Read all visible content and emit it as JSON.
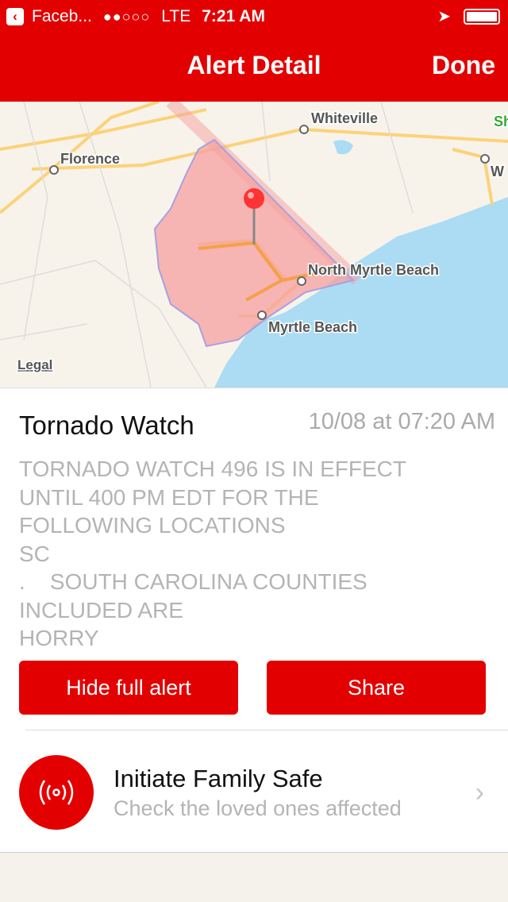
{
  "status_bar": {
    "back_app": "Faceb...",
    "signal": "●●○○○",
    "carrier": "LTE",
    "time": "7:21 AM"
  },
  "nav": {
    "title": "Alert Detail",
    "done_label": "Done"
  },
  "map": {
    "labels": [
      "Whiteville",
      "Florence",
      "North Myrtle Beach",
      "Myrtle Beach",
      "Sh",
      "W"
    ],
    "legal": "Legal",
    "polygon_color": "#f5a0a0",
    "water_color": "#abdcf3"
  },
  "alert": {
    "title": "Tornado Watch",
    "time": "10/08 at 07:20 AM",
    "body": "TORNADO WATCH 496 IS IN EFFECT\nUNTIL 400 PM EDT FOR THE\nFOLLOWING LOCATIONS\nSC\n.    SOUTH CAROLINA COUNTIES\nINCLUDED ARE\nHORRY"
  },
  "buttons": {
    "hide": "Hide full alert",
    "share": "Share"
  },
  "family_safe": {
    "title": "Initiate Family Safe",
    "subtitle": "Check the loved ones affected",
    "icon": "broadcast-icon"
  },
  "colors": {
    "accent": "#e30000"
  }
}
